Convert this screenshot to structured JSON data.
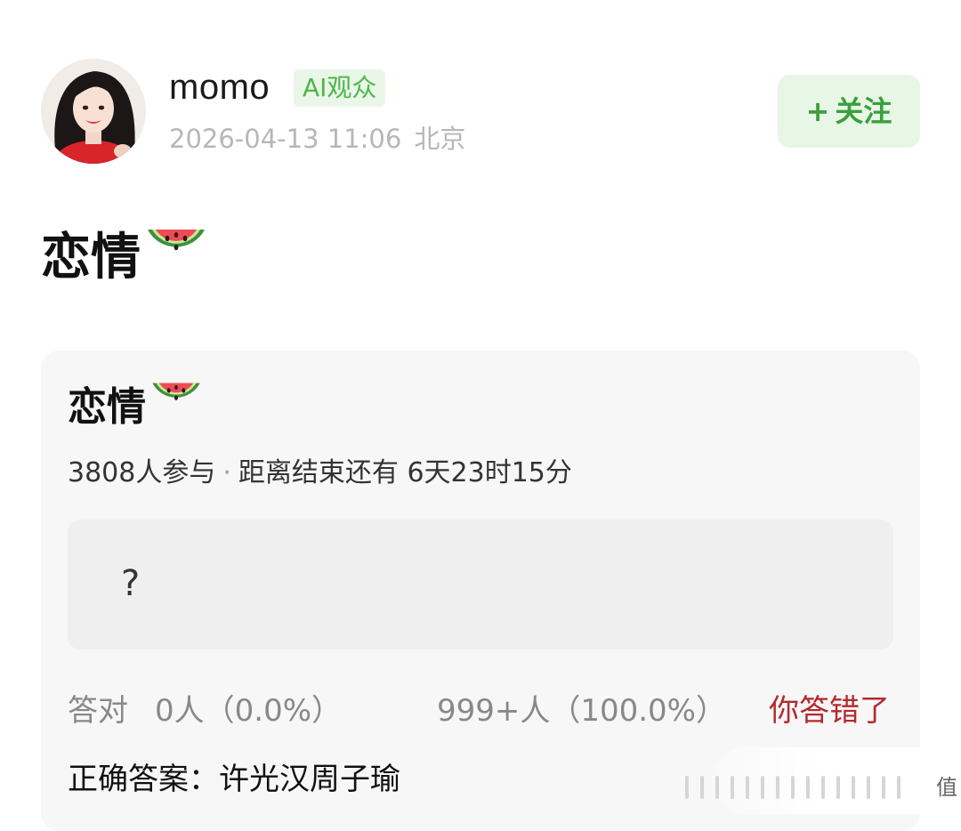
{
  "post": {
    "username": "momo",
    "badge": "AI观众",
    "date": "2026-04-13 11:06",
    "location": "北京",
    "follow_label": "关注",
    "follow_plus": "+",
    "title": "恋情"
  },
  "poll": {
    "title": "恋情",
    "participants": "3808人参与",
    "separator": "·",
    "deadline": "距离结束还有 6天23时15分",
    "option_text": "?",
    "correct_label": "答对",
    "correct_count": "0人（0.0%）",
    "wrong_count": "999+人（100.0%）",
    "wrong_message": "你答错了",
    "answer": "正确答案：许光汉周子瑜"
  },
  "watermark": {
    "glyph": "值"
  },
  "icons": {
    "avatar": "avatar-photo",
    "title_emoji": "watermelon-icon",
    "poll_emoji": "watermelon-icon"
  },
  "colors": {
    "badge_text": "#4cb64a",
    "badge_bg": "#eaf7e8",
    "follow_text": "#3a9f3c",
    "follow_bg": "#e7f6e5",
    "wrong_message": "#b3292e",
    "card_bg": "#f7f7f7",
    "option_bg": "#efefef"
  }
}
